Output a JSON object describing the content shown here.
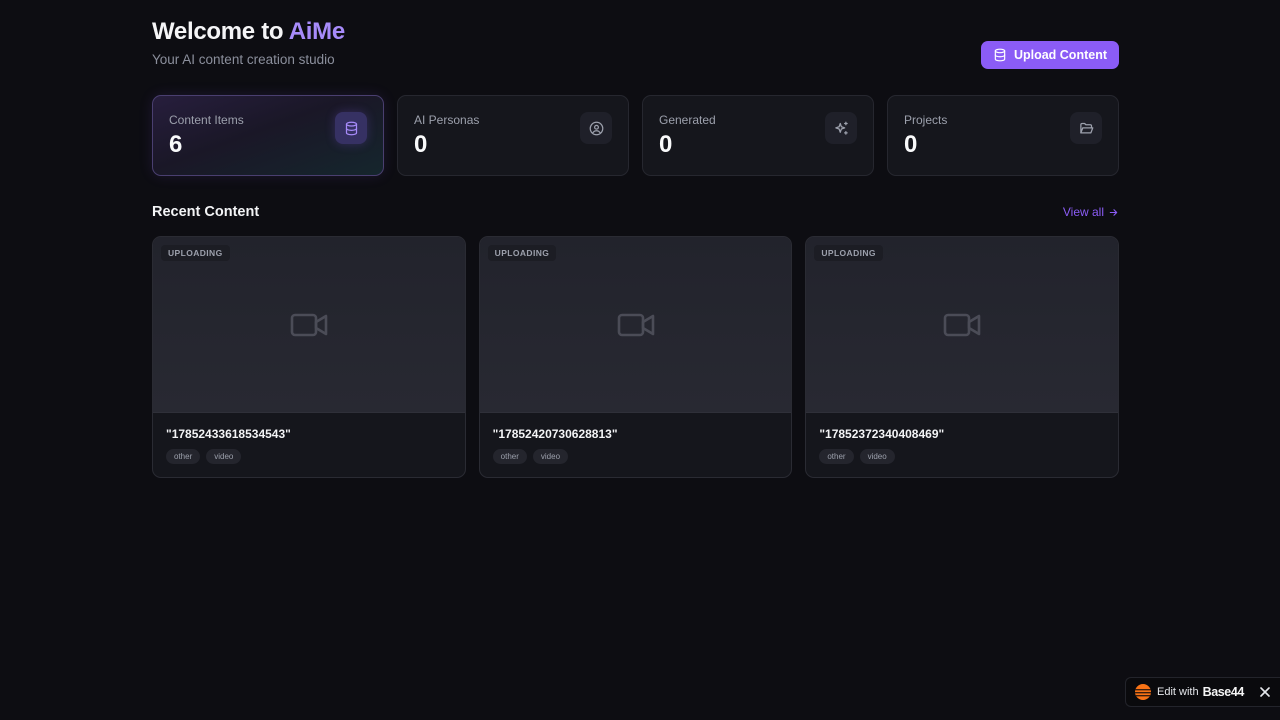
{
  "header": {
    "title_prefix": "Welcome to ",
    "brand": "AiMe",
    "subtitle": "Your AI content creation studio",
    "upload_label": "Upload Content"
  },
  "stats": [
    {
      "label": "Content Items",
      "value": "6",
      "icon": "database-icon"
    },
    {
      "label": "AI Personas",
      "value": "0",
      "icon": "user-circle-icon"
    },
    {
      "label": "Generated",
      "value": "0",
      "icon": "sparkles-icon"
    },
    {
      "label": "Projects",
      "value": "0",
      "icon": "folder-open-icon"
    }
  ],
  "recent": {
    "title": "Recent Content",
    "view_all": "View all"
  },
  "content": [
    {
      "status": "UPLOADING",
      "title": "\"17852433618534543\"",
      "tags": [
        "other",
        "video"
      ]
    },
    {
      "status": "UPLOADING",
      "title": "\"17852420730628813\"",
      "tags": [
        "other",
        "video"
      ]
    },
    {
      "status": "UPLOADING",
      "title": "\"17852372340408469\"",
      "tags": [
        "other",
        "video"
      ]
    }
  ],
  "badge": {
    "edit_with": "Edit with",
    "name": "Base44"
  },
  "colors": {
    "background": "#0d0d12",
    "accent": "#8b5cf6",
    "brand_text": "#a78bfa",
    "card": "#15161c"
  }
}
